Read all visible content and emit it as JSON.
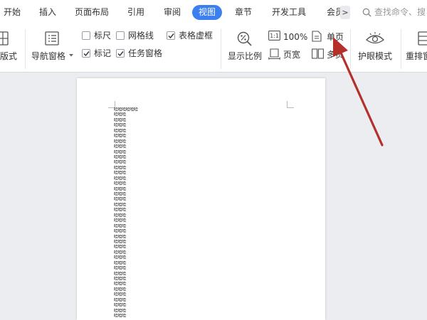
{
  "tabs": [
    {
      "label": "开始",
      "active": false
    },
    {
      "label": "插入",
      "active": false
    },
    {
      "label": "页面布局",
      "active": false
    },
    {
      "label": "引用",
      "active": false
    },
    {
      "label": "审阅",
      "active": false
    },
    {
      "label": "视图",
      "active": true
    },
    {
      "label": "章节",
      "active": false
    },
    {
      "label": "开发工具",
      "active": false
    },
    {
      "label": "会员",
      "active": false
    }
  ],
  "more_tabs_label": ">",
  "search": {
    "placeholder": "查找命令、搜"
  },
  "ribbon": {
    "layout_label": "版式",
    "nav_pane_label": "导航窗格",
    "checkboxes": [
      {
        "label": "标尺",
        "checked": false
      },
      {
        "label": "网格线",
        "checked": false
      },
      {
        "label": "表格虚框",
        "checked": true
      },
      {
        "label": "标记",
        "checked": true
      },
      {
        "label": "任务窗格",
        "checked": true
      }
    ],
    "zoom_ratio_label": "显示比例",
    "zoom_100_label": "100%",
    "page_width_label": "页宽",
    "single_page_label": "单页",
    "multi_page_label": "多页",
    "eye_mode_label": "护眼模式",
    "rearrange_label": "重排窗"
  },
  "document": {
    "first_line": "哈哈哈哈哈哈",
    "repeat_line": "哈哈哈",
    "repeat_count": 39
  },
  "colors": {
    "accent": "#3c7ff0",
    "annotation_arrow": "#b3302b"
  }
}
